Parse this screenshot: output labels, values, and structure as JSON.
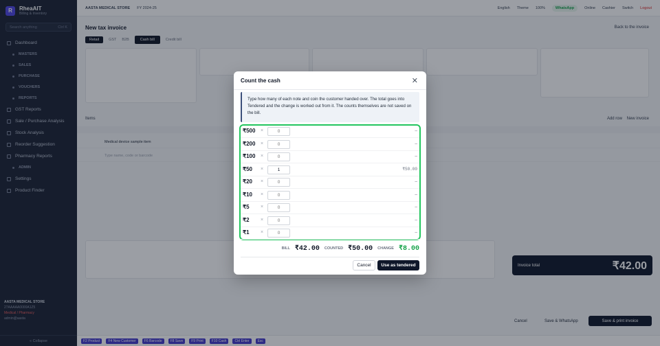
{
  "sidebar": {
    "brand": "RheaAIT",
    "brand_sub": "Billing & Inventory",
    "search_placeholder": "Search anything",
    "search_shortcut": "Ctrl K",
    "items": [
      {
        "label": "Dashboard",
        "type": "item"
      },
      {
        "label": "MASTERS",
        "type": "section"
      },
      {
        "label": "SALES",
        "type": "section"
      },
      {
        "label": "PURCHASE",
        "type": "section"
      },
      {
        "label": "VOUCHERS",
        "type": "section"
      },
      {
        "label": "REPORTS",
        "type": "section"
      },
      {
        "label": "GST Reports",
        "type": "item"
      },
      {
        "label": "Sale / Purchase Analysis",
        "type": "item"
      },
      {
        "label": "Stock Analysis",
        "type": "item"
      },
      {
        "label": "Reorder Suggestion",
        "type": "item"
      },
      {
        "label": "Pharmacy Reports",
        "type": "item"
      },
      {
        "label": "ADMIN",
        "type": "section"
      },
      {
        "label": "Settings",
        "type": "item"
      },
      {
        "label": "Product Finder",
        "type": "item"
      }
    ],
    "store_name": "AASTA MEDICAL STORE",
    "store_code": "27AAAAA0000A1Z5",
    "store_type": "Medical / Pharmacy",
    "user": "admin@aasta",
    "collapse": "« Collapse"
  },
  "topbar": {
    "store": "AASTA MEDICAL STORE",
    "fy": "FY 2024-25",
    "lang": "English",
    "theme": "Theme",
    "zoom": "100%",
    "whatsapp": "WhatsApp",
    "status": "Online",
    "user": "Cashier",
    "switch": "Switch",
    "logout": "Logout"
  },
  "page": {
    "title": "New tax invoice",
    "back": "Back to the invoice",
    "tabs": [
      "Retail",
      "GST",
      "B2B"
    ],
    "tab_extra": "Credit bill",
    "action": "Cash bill",
    "items_label": "Items",
    "add_row": "Add row",
    "new_invoice": "New invoice",
    "col_name": "Item",
    "row1": "Medical device sample item",
    "row2": "Type name, code or barcode",
    "total_label": "Invoice total",
    "total_amount": "₹42.00",
    "save_print": "Save & print invoice",
    "save_whatsapp": "Save & WhatsApp",
    "cancel": "Cancel",
    "bottom_shortcuts": [
      "F2 Product",
      "F4 New Customer",
      "F6 Barcode",
      "F8 Save",
      "F9 Print",
      "F10 Cash",
      "Ctrl Enter",
      "Esc"
    ]
  },
  "modal": {
    "title": "Count the cash",
    "info": "Type how many of each note and coin the customer handed over. The total goes into Tendered and the change is worked out from it. The counts themselves are not saved on the bill.",
    "denominations": [
      {
        "label": "₹500",
        "count": "",
        "amount": "—"
      },
      {
        "label": "₹200",
        "count": "",
        "amount": "—"
      },
      {
        "label": "₹100",
        "count": "",
        "amount": "—"
      },
      {
        "label": "₹50",
        "count": "1",
        "amount": "₹50.00"
      },
      {
        "label": "₹20",
        "count": "",
        "amount": "—"
      },
      {
        "label": "₹10",
        "count": "",
        "amount": "—"
      },
      {
        "label": "₹5",
        "count": "",
        "amount": "—"
      },
      {
        "label": "₹2",
        "count": "",
        "amount": "—"
      },
      {
        "label": "₹1",
        "count": "",
        "amount": "—"
      }
    ],
    "count_placeholder": "0",
    "times": "×",
    "bill_label": "BILL",
    "bill": "₹42.00",
    "counted_label": "COUNTED",
    "counted": "₹50.00",
    "change_label": "CHANGE",
    "change": "₹8.00",
    "cancel": "Cancel",
    "use": "Use as tendered",
    "colors": {
      "accent": "#22c55e",
      "change": "#16a34a",
      "primary": "#0f172a"
    }
  }
}
